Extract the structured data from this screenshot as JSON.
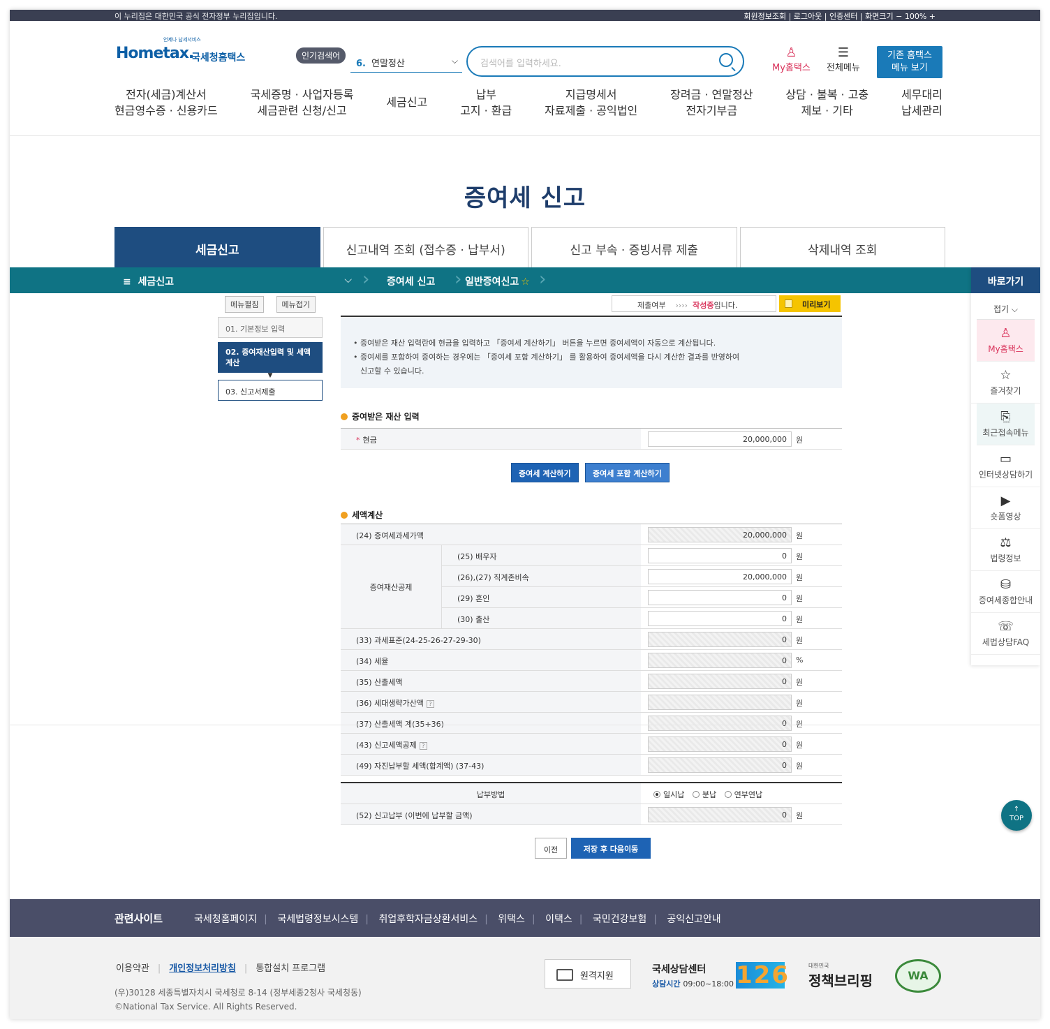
{
  "topbar": {
    "left_text": "이 누리집은 대한민국 공식 전자정부 누리집입니다.",
    "right_text": "회원정보조회 | 로그아웃 | 인증센터 | 화면크기 − 100% +"
  },
  "header": {
    "logo_small": "언제나 납세서비스",
    "logo_main": "Hometax.",
    "logo_kr": "국세청홈택스",
    "popular_badge": "인기검색어",
    "popular_num": "6.",
    "popular_term": "연말정산",
    "search_placeholder": "검색어를 입력하세요.",
    "my_label": "My홈택스",
    "allmenu_label": "전체메뉴",
    "oldmenu_line1": "기존 홈택스",
    "oldmenu_line2": "메뉴 보기"
  },
  "gnb": [
    "전자(세금)계산서\n현금영수증 · 신용카드",
    "국세증명 · 사업자등록\n세금관련 신청/신고",
    "세금신고",
    "납부\n고지 · 환급",
    "지급명세서\n자료제출 · 공익법인",
    "장려금 · 연말정산\n전자기부금",
    "상담 · 불복 · 고충\n제보 · 기타",
    "세무대리\n납세관리"
  ],
  "page_title": "증여세 신고",
  "tabs": [
    "세금신고",
    "신고내역 조회 (접수증 · 납부서)",
    "신고 부속 · 증빙서류 제출",
    "삭제내역 조회"
  ],
  "location": {
    "home": "세금신고",
    "item1": "증여세 신고",
    "item2": "일반증여신고"
  },
  "quick": {
    "title": "바로가기",
    "fold": "접기",
    "items": [
      "My홈택스",
      "즐겨찾기",
      "최근접속메뉴",
      "인터넷상담하기",
      "숏폼영상",
      "법령정보",
      "증여세종합안내",
      "세법상담FAQ"
    ]
  },
  "side": {
    "expand": "메뉴펼침",
    "collapse": "메뉴접기",
    "step1": "01. 기본정보 입력",
    "step2": "02. 증여재산입력 및 세액계산",
    "step3": "03. 신고서제출"
  },
  "status": {
    "label": "제출여부",
    "arrows": "››››",
    "state": "작성중",
    "suffix": "입니다.",
    "preview": "미리보기"
  },
  "info": {
    "line1": "증여받은 재산 입력란에 현금을 입력하고 「증여세 계산하기」 버튼을 누르면 증여세액이 자동으로 계산됩니다.",
    "line2": "증여세를 포함하여 증여하는 경우에는 「증여세 포함 계산하기」 를 활용하여 증여세액을 다시 계산한 결과를 반영하여",
    "line3": "신고할 수 있습니다."
  },
  "asset": {
    "section": "증여받은 재산 입력",
    "cash_label": "현금",
    "cash_value": "20,000,000",
    "unit": "원",
    "btn_calc": "증여세 계산하기",
    "btn_calc_incl": "증여세 포함 계산하기"
  },
  "tax": {
    "section": "세액계산",
    "group_label": "증여재산공제",
    "rows": [
      {
        "label": "(24) 증여세과세가액",
        "value": "20,000,000",
        "unit": "원"
      },
      {
        "label": "(25) 배우자",
        "value": "0",
        "unit": "원"
      },
      {
        "label": "(26),(27) 직계존비속",
        "value": "20,000,000",
        "unit": "원"
      },
      {
        "label": "(29) 혼인",
        "value": "0",
        "unit": "원"
      },
      {
        "label": "(30) 출산",
        "value": "0",
        "unit": "원"
      },
      {
        "label": "(33) 과세표준(24-25-26-27-29-30)",
        "value": "0",
        "unit": "원"
      },
      {
        "label": "(34) 세율",
        "value": "0",
        "unit": "%"
      },
      {
        "label": "(35) 산출세액",
        "value": "0",
        "unit": "원"
      },
      {
        "label": "(36) 세대생략가산액",
        "value": "",
        "unit": "원"
      },
      {
        "label": "(37) 산출세액 계(35+36)",
        "value": "0",
        "unit": "원"
      },
      {
        "label": "(43) 신고세액공제",
        "value": "0",
        "unit": "원"
      },
      {
        "label": "(49) 자진납부할 세액(합계액) (37-43)",
        "value": "0",
        "unit": "원"
      }
    ]
  },
  "payment": {
    "method_label": "납부방법",
    "opt1": "일시납",
    "opt2": "분납",
    "opt3": "연부연납",
    "selected": "일시납",
    "amount_label": "(52) 신고납부 (이번에 납부할 금액)",
    "amount_value": "0",
    "unit": "원"
  },
  "buttons": {
    "prev": "이전",
    "next": "저장 후 다음이동",
    "top": "TOP"
  },
  "footer": {
    "related": "관련사이트",
    "links": [
      "국세청홈페이지",
      "국세법령정보시스템",
      "취업후학자금상환서비스",
      "위택스",
      "이택스",
      "국민건강보험",
      "공익신고안내"
    ],
    "terms": "이용약관",
    "privacy": "개인정보처리방침",
    "install": "통합설치 프로그램",
    "address": "(우)30128 세종특별자치시 국세청로 8-14 (정부세종2청사 국세청동)",
    "copyright": "©National Tax Service. All Rights Reserved.",
    "remote": "원격지원",
    "center": "국세상담센터",
    "hours_label": "상담시간",
    "hours": "09:00~18:00",
    "phone": "126",
    "brief_small": "대한민국",
    "brief": "정책브리핑",
    "wa": "WA"
  }
}
